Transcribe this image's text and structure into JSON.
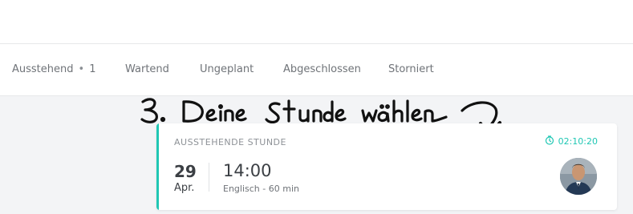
{
  "tabs": [
    {
      "label": "Ausstehend",
      "count": "1"
    },
    {
      "label": "Wartend"
    },
    {
      "label": "Ungeplant"
    },
    {
      "label": "Abgeschlossen"
    },
    {
      "label": "Storniert"
    }
  ],
  "annotation": {
    "text": "3. Deine stunde wählen"
  },
  "card": {
    "header": "AUSSTEHENDE STUNDE",
    "timer": "02:10:20",
    "day": "29",
    "month": "Apr.",
    "time": "14:00",
    "details": "Englisch - 60 min",
    "timer_icon": "clock-icon"
  },
  "colors": {
    "accent": "#20c7b4",
    "text_dark": "#3b3f44",
    "text_muted": "#6f7378"
  }
}
